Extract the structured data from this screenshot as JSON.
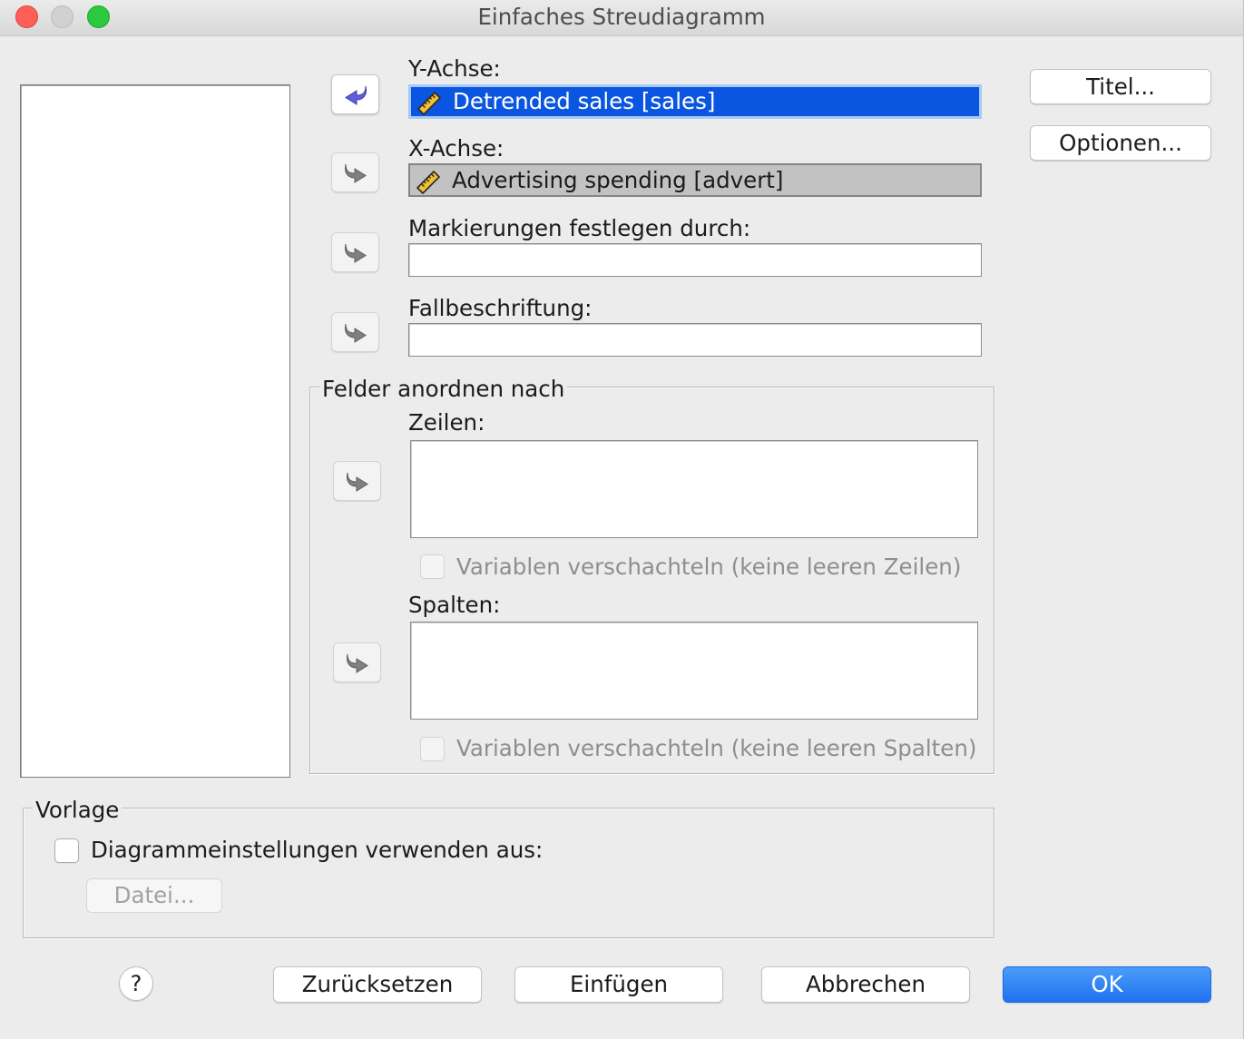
{
  "window": {
    "title": "Einfaches Streudiagramm"
  },
  "targets": {
    "y_axis": {
      "label": "Y-Achse:",
      "value": "Detrended sales [sales]",
      "icon": "ruler-icon",
      "move_icon": "arrow-left-icon"
    },
    "x_axis": {
      "label": "X-Achse:",
      "value": "Advertising spending [advert]",
      "icon": "ruler-icon",
      "move_icon": "arrow-right-icon"
    },
    "markers": {
      "label": "Markierungen festlegen durch:",
      "move_icon": "arrow-right-icon"
    },
    "case_labels": {
      "label": "Fallbeschriftung:",
      "move_icon": "arrow-right-icon"
    }
  },
  "panel": {
    "legend": "Felder anordnen nach",
    "rows": {
      "label": "Zeilen:",
      "nest_label": "Variablen verschachteln (keine leeren Zeilen)",
      "nest_checked": false,
      "nest_enabled": false
    },
    "columns": {
      "label": "Spalten:",
      "nest_label": "Variablen verschachteln (keine leeren Spalten)",
      "nest_checked": false,
      "nest_enabled": false
    }
  },
  "side_buttons": {
    "titles": "Titel...",
    "options": "Optionen..."
  },
  "template": {
    "legend": "Vorlage",
    "use_label": "Diagrammeinstellungen verwenden aus:",
    "use_checked": false,
    "file_button": "Datei...",
    "file_enabled": false
  },
  "footer": {
    "help": "?",
    "reset": "Zurücksetzen",
    "paste": "Einfügen",
    "cancel": "Abbrechen",
    "ok": "OK"
  },
  "colors": {
    "selection": "#0b56e0",
    "default_button": "#1f72ef",
    "move_arrow_active": "#5e5ed6",
    "move_arrow_inactive": "#808080",
    "disabled_text": "#8e8e8e"
  }
}
